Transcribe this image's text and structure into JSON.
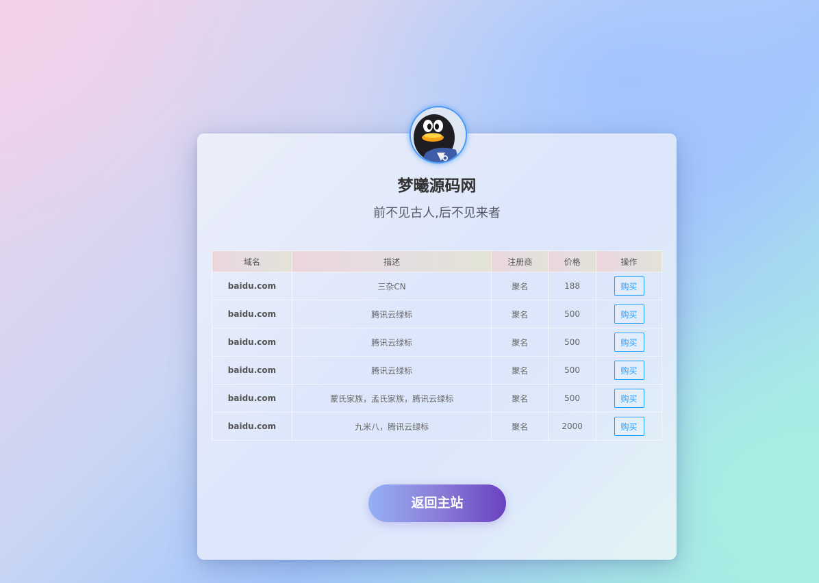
{
  "site": {
    "title": "梦曦源码网",
    "subtitle": "前不见古人,后不见来者"
  },
  "avatar": {
    "icon": "qq-penguin-icon"
  },
  "table": {
    "headers": [
      "域名",
      "描述",
      "注册商",
      "价格",
      "操作"
    ],
    "rows": [
      {
        "domain": "baidu.com",
        "description": "三杂CN",
        "registrar": "聚名",
        "price": "188",
        "action": "购买"
      },
      {
        "domain": "baidu.com",
        "description": "腾讯云绿标",
        "registrar": "聚名",
        "price": "500",
        "action": "购买"
      },
      {
        "domain": "baidu.com",
        "description": "腾讯云绿标",
        "registrar": "聚名",
        "price": "500",
        "action": "购买"
      },
      {
        "domain": "baidu.com",
        "description": "腾讯云绿标",
        "registrar": "聚名",
        "price": "500",
        "action": "购买"
      },
      {
        "domain": "baidu.com",
        "description": "蒙氏家族，孟氏家族，腾讯云绿标",
        "registrar": "聚名",
        "price": "500",
        "action": "购买"
      },
      {
        "domain": "baidu.com",
        "description": "九米八，腾讯云绿标",
        "registrar": "聚名",
        "price": "2000",
        "action": "购买"
      }
    ]
  },
  "back_button": {
    "label": "返回主站"
  },
  "colors": {
    "accent": "#1e9fff",
    "button_gradient_start": "#96b0f5",
    "button_gradient_end": "#6a42c0"
  }
}
